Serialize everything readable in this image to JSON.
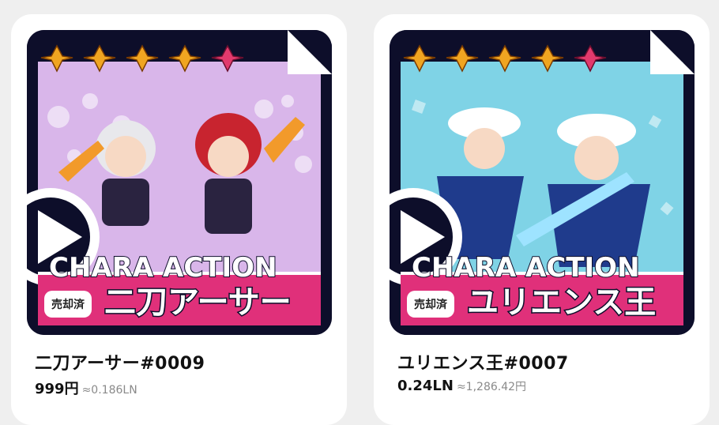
{
  "cards": [
    {
      "overlay_label": "CHARA ACTION",
      "overlay_name": "二刀アーサー",
      "badge": "売却済",
      "title": "二刀アーサー#0009",
      "price": "999円",
      "sub_price": "≈0.186LN",
      "rarity_stars": 5,
      "colors": {
        "accent": "#e0307a",
        "panel": "#d9b6ea",
        "star": "#f0a521",
        "star_last": "#e23a6d"
      },
      "icons": [
        "star-icon",
        "play-icon"
      ]
    },
    {
      "overlay_label": "CHARA ACTION",
      "overlay_name": "ユリエンス王",
      "badge": "売却済",
      "title": "ユリエンス王#0007",
      "price": "0.24LN",
      "sub_price": "≈1,286.42円",
      "rarity_stars": 5,
      "colors": {
        "accent": "#e0307a",
        "panel": "#7fd3e6",
        "star": "#f0a521",
        "star_last": "#e23a6d"
      },
      "icons": [
        "star-icon",
        "play-icon"
      ]
    }
  ]
}
